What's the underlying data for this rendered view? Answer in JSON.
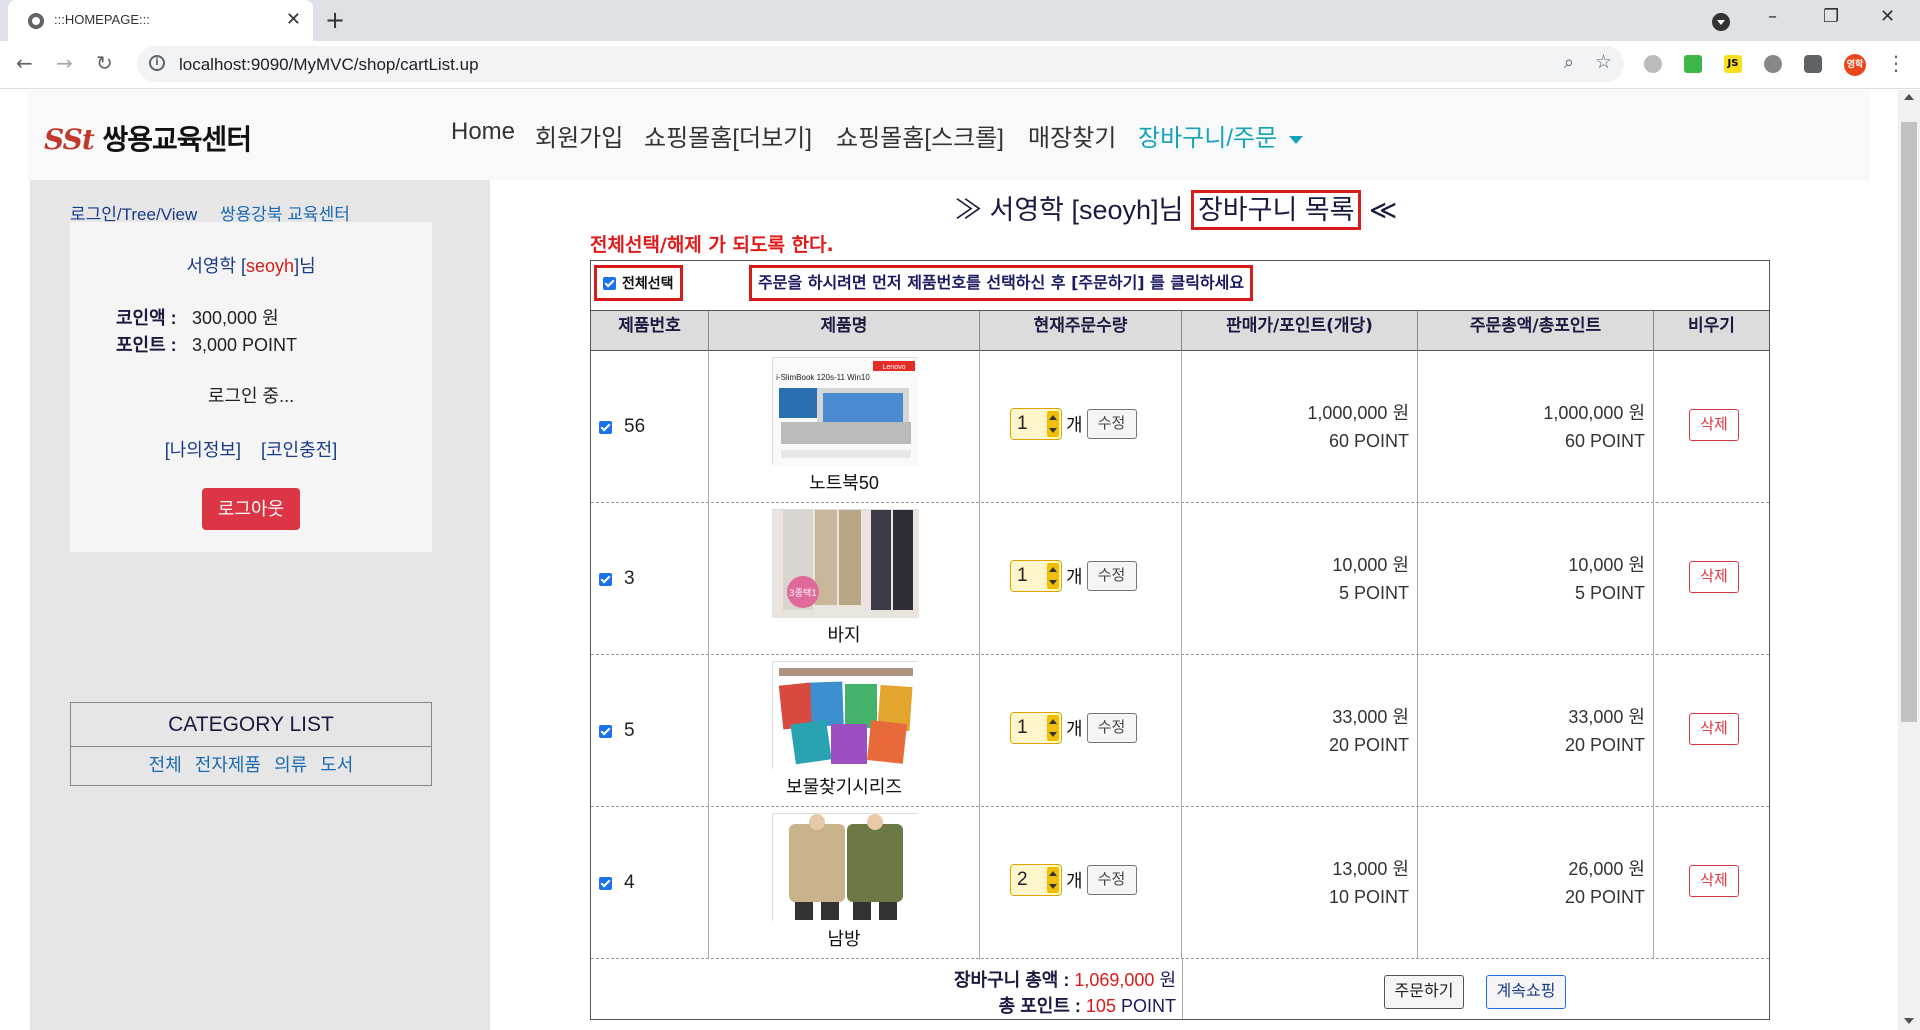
{
  "browser": {
    "tab_title": ":::HOMEPAGE:::",
    "url": "localhost:9090/MyMVC/shop/cartList.up",
    "profile_label": "영학",
    "ext_js": "JS"
  },
  "navbar": {
    "brand": "쌍용교육센터",
    "brand_mark": "SSt",
    "items": [
      "Home",
      "회원가입",
      "쇼핑몰홈[더보기]",
      "쇼핑몰홈[스크롤]",
      "매장찾기"
    ],
    "active_item": "장바구니/주문"
  },
  "sidebar": {
    "link1": "로그인/Tree/View",
    "link2": "쌍용강북 교육센터",
    "user_name": "서영학",
    "user_id": "seoyh",
    "user_suffix": "님",
    "coin_label": "코인액 :",
    "coin_value": "300,000 원",
    "point_label": "포인트 :",
    "point_value": "3,000 POINT",
    "status": "로그인 중...",
    "myinfo": "[나의정보]",
    "coin_charge": "[코인충전]",
    "logout": "로그아웃",
    "category_title": "CATEGORY LIST",
    "categories": [
      "전체",
      "전자제품",
      "의류",
      "도서"
    ]
  },
  "cart": {
    "title_prefix": "≫ 서영학 [seoyh]님",
    "title_boxed": "장바구니 목록",
    "title_suffix": "≪",
    "note": "전체선택/해제 가 되도록 한다.",
    "select_all": "전체선택",
    "instruction": "주문을 하시려면 먼저 제품번호를 선택하신 후 [주문하기] 를 클릭하세요",
    "headers": [
      "제품번호",
      "제품명",
      "현재주문수량",
      "판매가/포인트(개당)",
      "주문총액/총포인트",
      "비우기"
    ],
    "edit_label": "수정",
    "unit_label": "개",
    "delete_label": "삭제",
    "rows": [
      {
        "pno": "56",
        "name": "노트북50",
        "qty": "1",
        "price": "1,000,000 원",
        "point": "60 POINT",
        "total": "1,000,000 원",
        "total_point": "60 POINT"
      },
      {
        "pno": "3",
        "name": "바지",
        "qty": "1",
        "price": "10,000 원",
        "point": "5 POINT",
        "total": "10,000 원",
        "total_point": "5 POINT"
      },
      {
        "pno": "5",
        "name": "보물찾기시리즈",
        "qty": "1",
        "price": "33,000 원",
        "point": "20 POINT",
        "total": "33,000 원",
        "total_point": "20 POINT"
      },
      {
        "pno": "4",
        "name": "남방",
        "qty": "2",
        "price": "13,000 원",
        "point": "10 POINT",
        "total": "26,000 원",
        "total_point": "20 POINT"
      }
    ],
    "sum_label": "장바구니 총액 :",
    "sum_value": "1,069,000",
    "sum_unit": "원",
    "point_label": "총 포인트 :",
    "point_value": "105",
    "point_unit": "POINT",
    "order_btn": "주문하기",
    "continue_btn": "계속쇼핑"
  },
  "product_image_text": {
    "laptop_brand": "Lenovo",
    "laptop_model": "i-SlimBook 120s-11 Win10",
    "pants_badge": "3종택1"
  }
}
